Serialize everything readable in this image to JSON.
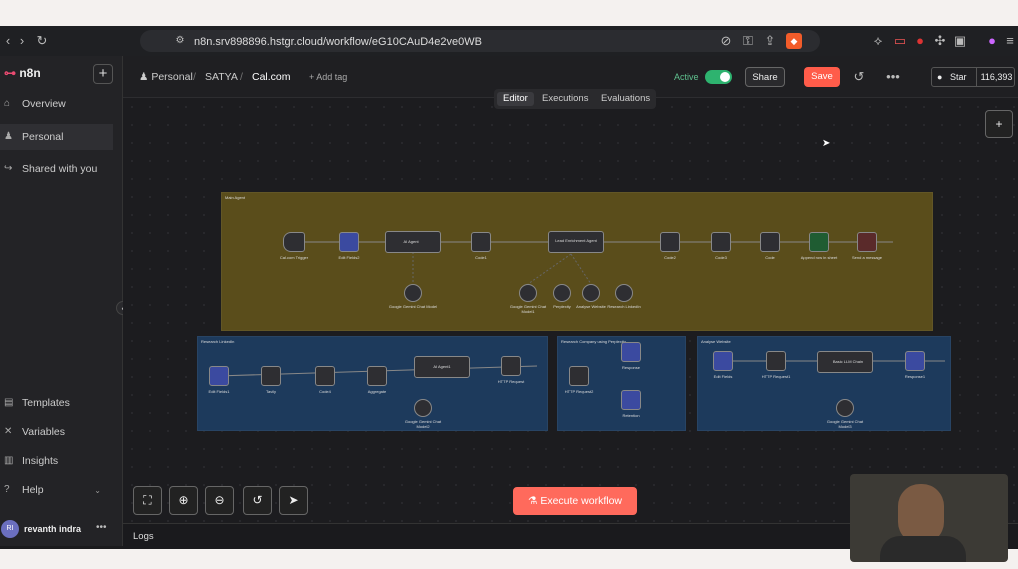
{
  "browser": {
    "url": "n8n.srv898896.hstgr.cloud/workflow/eG10CAuD4e2ve0WB"
  },
  "sidebar": {
    "logo": "n8n",
    "items": [
      {
        "label": "Overview",
        "icon": "home-icon"
      },
      {
        "label": "Personal",
        "icon": "user-icon"
      },
      {
        "label": "Shared with you",
        "icon": "share-icon"
      }
    ],
    "bottom_items": [
      {
        "label": "Templates",
        "icon": "templates-icon"
      },
      {
        "label": "Variables",
        "icon": "variables-icon"
      },
      {
        "label": "Insights",
        "icon": "insights-icon"
      },
      {
        "label": "Help",
        "icon": "help-icon"
      }
    ],
    "user": {
      "initials": "RI",
      "name": "revanth indra"
    }
  },
  "header": {
    "crumb_personal": "Personal",
    "crumb_folder": "SATYA",
    "workflow_name": "Cal.com",
    "add_tag": "+ Add tag",
    "active_label": "Active",
    "share": "Share",
    "save": "Save",
    "star": "Star",
    "star_count": "116,393"
  },
  "tabs": [
    "Editor",
    "Executions",
    "Evaluations"
  ],
  "sticky": {
    "main": "Main Agent",
    "research_linkedin": "Research LinkedIn",
    "research_company": "Research Company using Perplexity",
    "analyse_website": "Analyse Website"
  },
  "nodes": {
    "trigger": "Cal.com Trigger",
    "edit_fields2": "Edit Fields2",
    "ai_agent": "AI Agent",
    "code1": "Code1",
    "lead_agent": "Lead Enrichment Agent",
    "code2": "Code2",
    "code3": "Code3",
    "code": "Code",
    "append_sheet": "Append row in sheet",
    "send_message": "Send a message",
    "gemini_model": "Google Gemini Chat Model",
    "gemini_model1": "Google Gemini Chat Model1",
    "perplexity": "Perplexity",
    "analyse_website": "Analyse Website",
    "research_linkedin": "Research LinkedIn",
    "edit_fields1": "Edit Fields1",
    "tavily": "Tavily",
    "code4": "Code4",
    "aggregate": "Aggregate",
    "ai_agent1": "AI Agent1",
    "http_request": "HTTP Request",
    "gemini_model2": "Google Gemini Chat Model2",
    "http_request2": "HTTP Request2",
    "response": "Response",
    "retention": "Retention",
    "edit_fields": "Edit Fields",
    "http_request1": "HTTP Request1",
    "basic_llm": "Basic LLM Chain",
    "response1": "Response1",
    "gemini_model3": "Google Gemini Chat Model3"
  },
  "execute": "Execute workflow",
  "logs": "Logs"
}
